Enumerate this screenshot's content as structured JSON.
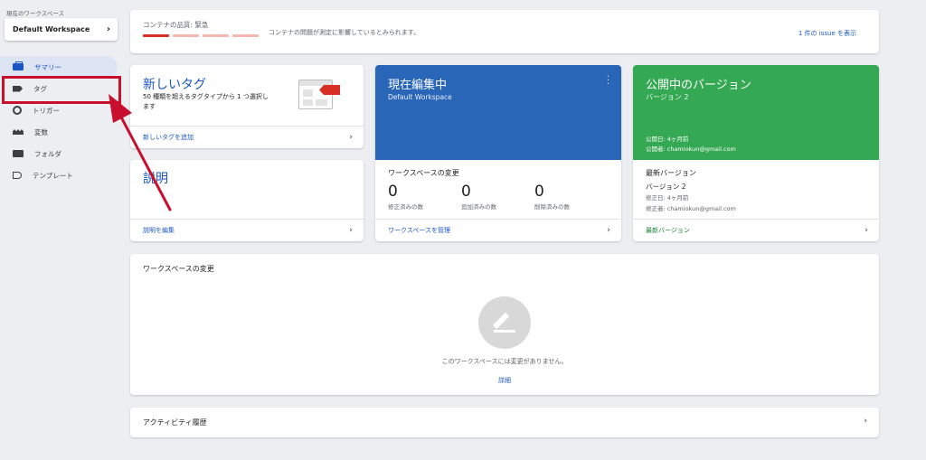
{
  "sidebar": {
    "workspace_label": "現在のワークスペース",
    "workspace_name": "Default Workspace",
    "items": [
      {
        "label": "サマリー",
        "icon": "summary-icon"
      },
      {
        "label": "タグ",
        "icon": "tag-icon"
      },
      {
        "label": "トリガー",
        "icon": "trigger-icon"
      },
      {
        "label": "変数",
        "icon": "variable-icon"
      },
      {
        "label": "フォルダ",
        "icon": "folder-icon"
      },
      {
        "label": "テンプレート",
        "icon": "template-icon"
      }
    ]
  },
  "quality": {
    "label": "コンテナの品質: 緊急",
    "message": "コンテナの問題が測定に影響しているとみられます。",
    "issue_link": "1 件の issue を表示"
  },
  "new_tag": {
    "title": "新しいタグ",
    "description": "50 種類を超えるタグタイプから 1 つ選択します",
    "footer_link": "新しいタグを追加"
  },
  "description_card": {
    "title": "説明",
    "footer_link": "説明を編集"
  },
  "current_edit": {
    "title": "現在編集中",
    "workspace": "Default Workspace",
    "section": "ワークスペースの変更",
    "stats": [
      {
        "value": "0",
        "label": "修正済みの数"
      },
      {
        "value": "0",
        "label": "追加済みの数"
      },
      {
        "value": "0",
        "label": "削除済みの数"
      }
    ],
    "footer_link": "ワークスペースを管理"
  },
  "published": {
    "title": "公開中のバージョン",
    "version": "バージョン 2",
    "published_date": "公開日: 4ヶ月前",
    "publisher": "公開者: chamiokun@gmail.com",
    "latest_title": "最新バージョン",
    "latest_version": "バージョン 2",
    "modified_date": "修正日: 4ヶ月前",
    "modifier": "修正者: chamiokun@gmail.com",
    "footer_link": "最新バージョン"
  },
  "changes": {
    "title": "ワークスペースの変更",
    "empty_message": "このワークスペースには変更がありません。",
    "detail_link": "詳細"
  },
  "activity": {
    "title": "アクティビティ履歴"
  },
  "colors": {
    "accent_blue": "#1a56c4",
    "header_blue": "#2a66b8",
    "header_green": "#34a853",
    "critical_red": "#d93025",
    "annotation_red": "#c8102e"
  }
}
